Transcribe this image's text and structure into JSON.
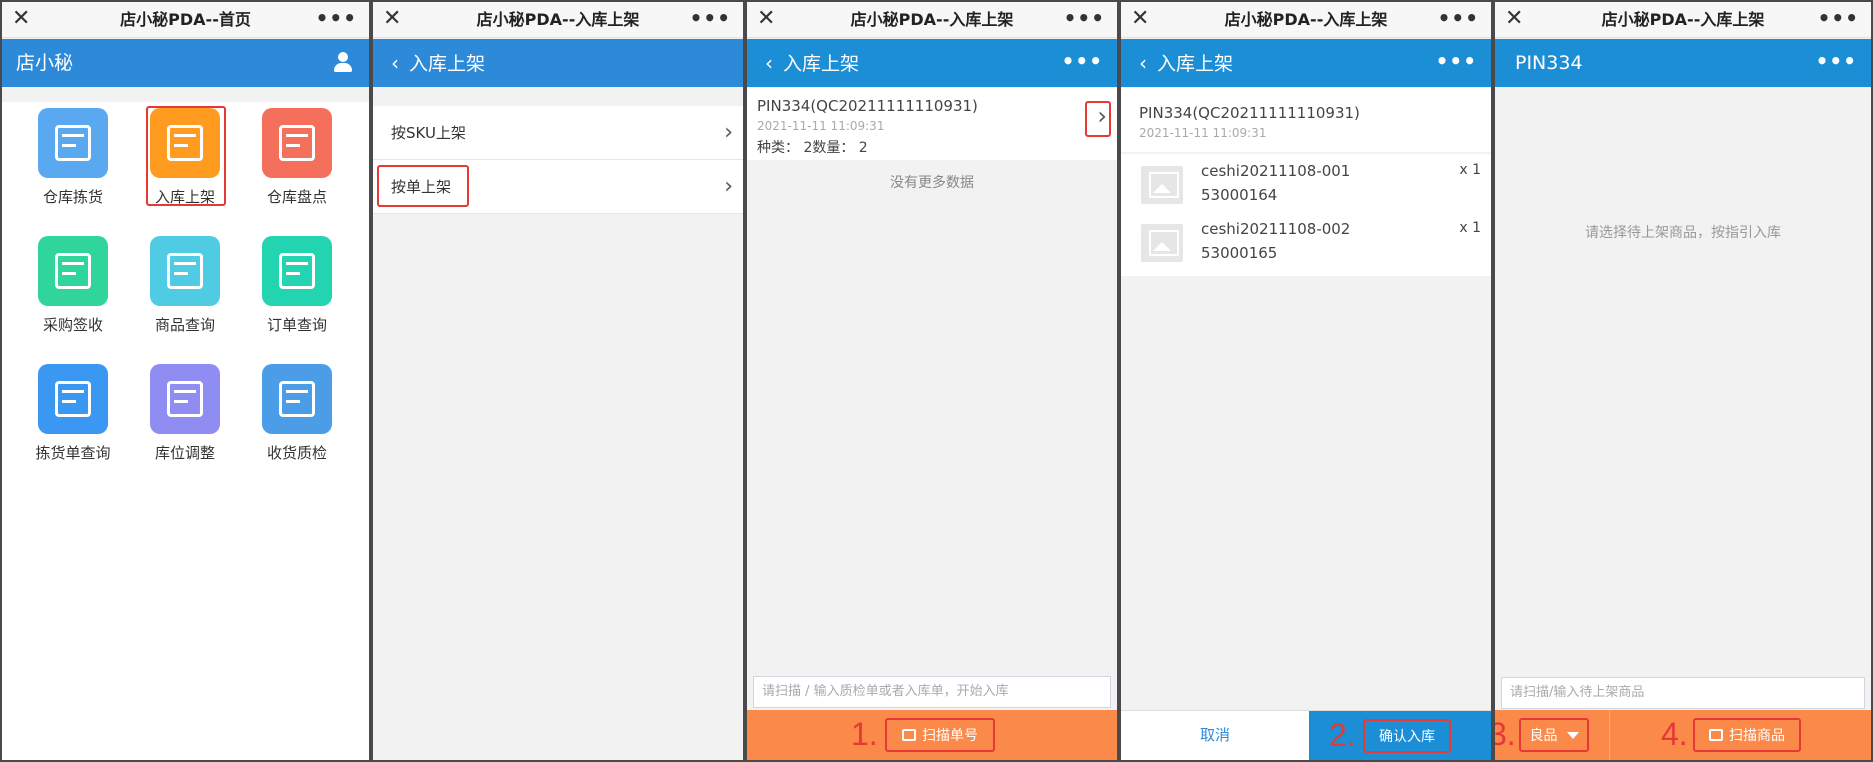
{
  "wechat": {
    "close_icon": "close-icon",
    "more_label": "•••"
  },
  "panels": {
    "home": {
      "window_title": "店小秘PDA--首页",
      "app_title": "店小秘",
      "tiles": [
        {
          "label": "仓库拣货",
          "color": "#5aa8ef"
        },
        {
          "label": "入库上架",
          "color": "#ff9c1f"
        },
        {
          "label": "仓库盘点",
          "color": "#f46f5c"
        },
        {
          "label": "采购签收",
          "color": "#2fd59a"
        },
        {
          "label": "商品查询",
          "color": "#4fcbe3"
        },
        {
          "label": "订单查询",
          "color": "#23d4b0"
        },
        {
          "label": "拣货单查询",
          "color": "#3b98f2"
        },
        {
          "label": "库位调整",
          "color": "#8f8cf2"
        },
        {
          "label": "收货质检",
          "color": "#4c9de8"
        }
      ]
    },
    "mode": {
      "window_title": "店小秘PDA--入库上架",
      "back_title": "入库上架",
      "items": [
        "按SKU上架",
        "按单上架"
      ]
    },
    "orders": {
      "window_title": "店小秘PDA--入库上架",
      "back_title": "入库上架",
      "order_id": "PIN334(QC20211111110931)",
      "order_time": "2021-11-11 11:09:31",
      "order_meta": "种类：  2数量：  2",
      "no_more": "没有更多数据",
      "scan_placeholder": "请扫描 / 输入质检单或者入库单，开始入库",
      "step_number": "1.",
      "scan_button": "扫描单号"
    },
    "detail": {
      "window_title": "店小秘PDA--入库上架",
      "back_title": "入库上架",
      "order_id": "PIN334(QC20211111110931)",
      "order_time": "2021-11-11 11:09:31",
      "items": [
        {
          "sku": "ceshi20211108-001",
          "code": "53000164",
          "qty": "x 1"
        },
        {
          "sku": "ceshi20211108-002",
          "code": "53000165",
          "qty": "x 1"
        }
      ],
      "cancel_button": "取消",
      "step_number": "2.",
      "confirm_button": "确认入库"
    },
    "putaway": {
      "window_title": "店小秘PDA--入库上架",
      "app_title": "PIN334",
      "hint": "请选择待上架商品，按指引入库",
      "scan_placeholder": "请扫描/输入待上架商品",
      "step3_number": "3.",
      "quality_select": "良品",
      "step4_number": "4.",
      "scan_button": "扫描商品"
    }
  },
  "colors": {
    "accent_blue": "#2d8ad9",
    "bottom_orange": "#fb8a4a",
    "highlight_red": "#e53935",
    "confirm_blue": "#1c8ed6"
  }
}
